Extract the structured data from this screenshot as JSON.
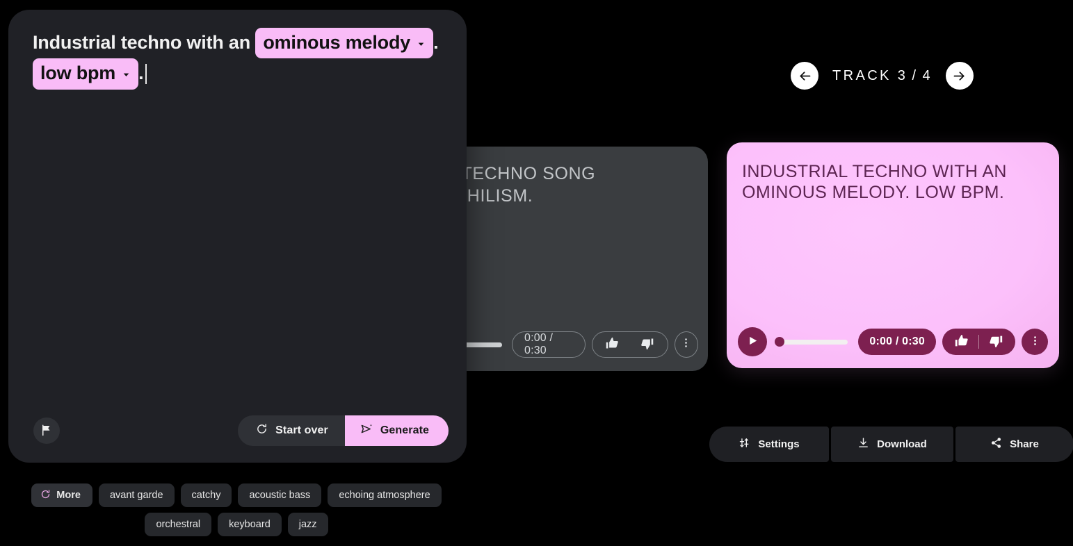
{
  "track_nav": {
    "prev_label": "arrow-left-icon",
    "next_label": "arrow-right-icon",
    "label_prefix": "TRACK",
    "position": "3 / 4"
  },
  "prompt": {
    "text_before_chip1": "Industrial techno with an ",
    "chip1": "ominous melody",
    "text_after_chip1": ".",
    "chip2": "low bpm",
    "text_after_chip2": ".",
    "start_over_label": "Start over",
    "generate_label": "Generate",
    "flag_icon": "flag-icon",
    "refresh_icon": "refresh-icon",
    "send_icon": "send-sparkle-icon"
  },
  "cards": {
    "background": {
      "title": "IAL TECHNO SONG\nG NIHILISM.",
      "time": "0:00 / 0:30"
    },
    "active": {
      "title": "INDUSTRIAL TECHNO WITH AN\nOMINOUS MELODY. LOW BPM.",
      "time": "0:00 / 0:30",
      "accent": "#7d2050",
      "surface": "#fcc0fb"
    }
  },
  "bottom_actions": [
    {
      "label": "Settings",
      "icon": "tune-icon"
    },
    {
      "label": "Download",
      "icon": "download-icon"
    },
    {
      "label": "Share",
      "icon": "share-icon"
    }
  ],
  "tags": {
    "more_label": "More",
    "row1": [
      "avant garde",
      "catchy",
      "acoustic bass",
      "echoing atmosphere"
    ],
    "row2": [
      "orchestral",
      "keyboard",
      "jazz"
    ]
  }
}
